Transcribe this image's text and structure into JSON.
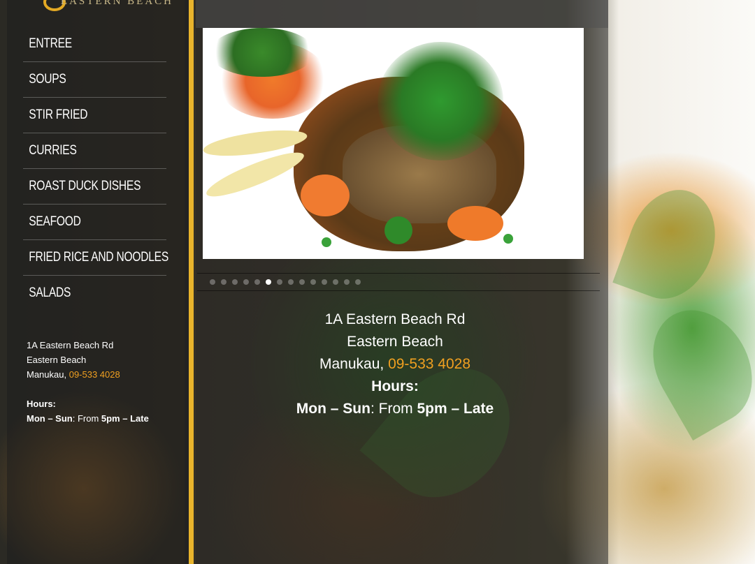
{
  "logo": {
    "text": "Eastern Beach"
  },
  "nav": {
    "items": [
      {
        "label": "ENTREE"
      },
      {
        "label": "SOUPS"
      },
      {
        "label": "STIR FRIED"
      },
      {
        "label": "CURRIES"
      },
      {
        "label": "ROAST DUCK DISHES"
      },
      {
        "label": "SEAFOOD"
      },
      {
        "label": "FRIED RICE AND NOODLES"
      },
      {
        "label": "SALADS"
      }
    ]
  },
  "sidebar_info": {
    "address_line1": "1A Eastern Beach Rd",
    "address_line2": "Eastern Beach",
    "city": "Manukau,",
    "phone": "09-533 4028",
    "hours_label": "Hours:",
    "hours_days": "Mon – Sun",
    "hours_from": ": From ",
    "hours_time": "5pm – Late"
  },
  "slider": {
    "dot_count": 14,
    "active_index": 5
  },
  "center_info": {
    "address_line1": "1A Eastern Beach Rd",
    "address_line2": "Eastern Beach",
    "city": "Manukau,",
    "phone": "09-533 4028",
    "hours_label": "Hours:",
    "hours_days": "Mon – Sun",
    "hours_from": ": From ",
    "hours_time": "5pm – Late"
  },
  "colors": {
    "accent_gold": "#e9b42c",
    "phone_orange": "#f0a020"
  }
}
